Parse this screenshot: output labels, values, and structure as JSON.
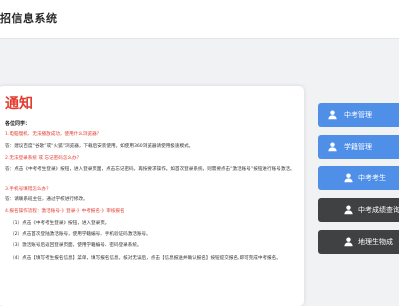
{
  "header": {
    "site_title": "招信息系统"
  },
  "notice": {
    "title": "通知",
    "greeting": "各位同学：",
    "items": [
      {
        "q": "1.电脑慢机、无法播放成功，使用什么浏览器？",
        "a": "答：建议百度“谷歌”或“火狐”浏览器，下载后安装使用。如使用360浏览器请使用极速模式。"
      },
      {
        "q": "2.无法登录系统 或 忘记密码怎么办？",
        "a": "答：点击《中考考生登录》按钮，进入登录页面，点击忘记密码，再按要求操作。如首次登录系统，则需要点击“激活账号”按钮进行账号激活。"
      },
      {
        "q": "3.手机号填错怎么办？",
        "a": "答：请联系班主任，通过学校进行修改。"
      }
    ],
    "flow_title": "4.报名操作流程：激活账号-》登录-》中考报名-》审核报名",
    "steps": [
      "（1）点击《中考考生登录》按钮，进入登录页。",
      "（2）点击首次登陆激活账号，使用学籍编号、手机验证码激活账号。",
      "（3）激活账号后返回登录页面，使用学籍编号、密码登录系统。",
      "（4）点击【填写考生报名信息】菜单，填写报名信息，核对无误后，点击【信息报送并确认报名】按钮提交报名,即可完成中考报名。"
    ]
  },
  "sidebar": {
    "buttons": [
      {
        "label": "中考管理",
        "icon": "user-icon",
        "style": "blue"
      },
      {
        "label": "学籍管理",
        "icon": "user-icon",
        "style": "blue"
      },
      {
        "label": "中考考生",
        "icon": "user-icon",
        "style": "blue"
      },
      {
        "label": "中考成绩查询",
        "icon": "user-icon",
        "style": "dark"
      },
      {
        "label": "地理生物成",
        "icon": "user-icon",
        "style": "dark"
      }
    ]
  },
  "colors": {
    "accent_red": "#e23b2e",
    "button_blue": "#4f8fe8",
    "button_dark": "#3f4142"
  }
}
